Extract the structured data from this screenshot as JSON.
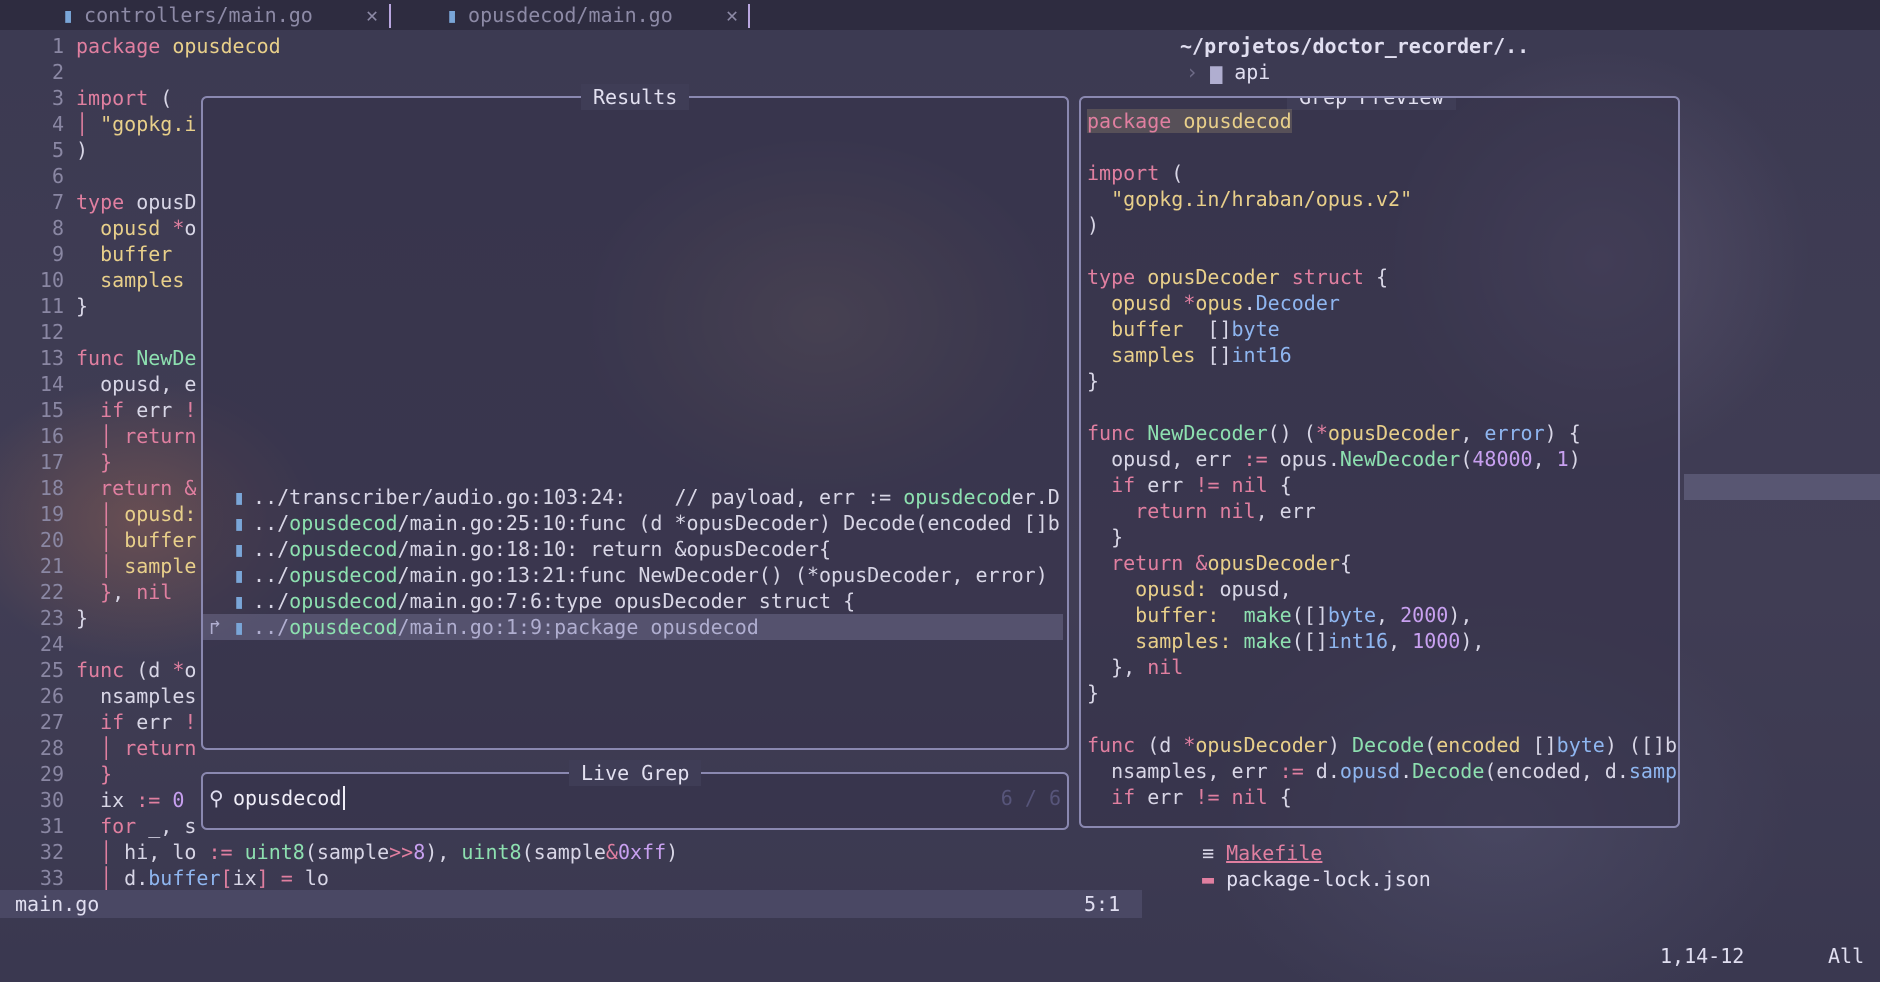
{
  "tabs": [
    {
      "label": "controllers/main.go",
      "close": "✕"
    },
    {
      "label": "opusdecod/main.go",
      "close": "✕"
    }
  ],
  "editor": {
    "lines": [
      {
        "n": "1",
        "html": "<span class='kw'>package</span> <span class='str'>opusdecod</span>"
      },
      {
        "n": "2",
        "html": ""
      },
      {
        "n": "3",
        "html": "<span class='kw'>import</span> ("
      },
      {
        "n": "4",
        "html": "<span class='guide'>│</span> <span class='str'>\"gopkg.i</span>"
      },
      {
        "n": "5",
        "html": ")"
      },
      {
        "n": "6",
        "html": ""
      },
      {
        "n": "7",
        "html": "<span class='kw'>type</span> opusD"
      },
      {
        "n": "8",
        "html": "  <span class='fld'>opusd</span> <span class='op'>*</span>o"
      },
      {
        "n": "9",
        "html": "  <span class='fld'>buffer</span>"
      },
      {
        "n": "10",
        "html": "  <span class='fld'>samples</span>"
      },
      {
        "n": "11",
        "html": "}"
      },
      {
        "n": "12",
        "html": ""
      },
      {
        "n": "13",
        "html": "<span class='kw'>func</span> <span class='fn'>NewDe</span>"
      },
      {
        "n": "14",
        "html": "  opusd, e"
      },
      {
        "n": "15",
        "html": "  <span class='kw'>if</span> err <span class='op'>!</span>"
      },
      {
        "n": "16",
        "html": "  <span class='guide'>│</span> <span class='kw'>return</span>"
      },
      {
        "n": "17",
        "html": "  <span class='guide'>}</span>"
      },
      {
        "n": "18",
        "html": "  <span class='kw'>return</span> <span class='op'>&amp;</span>"
      },
      {
        "n": "19",
        "html": "  <span class='guide'>│</span> <span class='fld'>opusd:</span>"
      },
      {
        "n": "20",
        "html": "  <span class='guide'>│</span> <span class='fld'>buffer</span>"
      },
      {
        "n": "21",
        "html": "  <span class='guide'>│</span> <span class='fld'>sample</span>"
      },
      {
        "n": "22",
        "html": "  <span class='guide'>}</span>, <span class='kw'>nil</span>"
      },
      {
        "n": "23",
        "html": "}"
      },
      {
        "n": "24",
        "html": ""
      },
      {
        "n": "25",
        "html": "<span class='kw'>func</span> (d <span class='op'>*</span>o"
      },
      {
        "n": "26",
        "html": "  nsamples"
      },
      {
        "n": "27",
        "html": "  <span class='kw'>if</span> err <span class='op'>!</span>"
      },
      {
        "n": "28",
        "html": "  <span class='guide'>│</span> <span class='kw'>return</span>"
      },
      {
        "n": "29",
        "html": "  <span class='guide'>}</span>"
      },
      {
        "n": "30",
        "html": "  ix <span class='op'>:=</span> <span class='num'>0</span>"
      },
      {
        "n": "31",
        "html": "  <span class='kw'>for</span> _, s"
      },
      {
        "n": "32",
        "html": "  <span class='guide'>│</span> hi, lo <span class='op'>:=</span> <span class='fn'>uint8</span>(sample<span class='op'>&gt;&gt;</span><span class='num'>8</span>), <span class='fn'>uint8</span>(sample<span class='op'>&amp;</span><span class='num'>0xff</span>)"
      },
      {
        "n": "33",
        "html": "  <span class='guide'>│</span> d.<span class='ty'>buffer</span><span class='op'>[</span>ix<span class='op'>]</span> <span class='op'>=</span> lo"
      }
    ]
  },
  "results": {
    "title": "Results",
    "rows": [
      {
        "path": "../transcriber/audio.go:103:24:    // payload, err := ",
        "match": "opusdecod",
        "rest": "er.D",
        "selected": false
      },
      {
        "path": "../",
        "match": "opusdecod",
        "rest": "/main.go:25:10:func (d *opusDecoder) Decode(encoded []b",
        "selected": false
      },
      {
        "path": "../",
        "match": "opusdecod",
        "rest": "/main.go:18:10: return &opusDecoder{",
        "selected": false
      },
      {
        "path": "../",
        "match": "opusdecod",
        "rest": "/main.go:13:21:func NewDecoder() (*opusDecoder, error)",
        "selected": false
      },
      {
        "path": "../",
        "match": "opusdecod",
        "rest": "/main.go:7:6:type opusDecoder struct {",
        "selected": false
      },
      {
        "path": "../",
        "match": "opusdecod",
        "rest": "/main.go:1:9:package opusdecod",
        "selected": true
      }
    ]
  },
  "live_grep": {
    "title": "Live Grep",
    "query": "opusdecod",
    "count": "6 / 6"
  },
  "preview": {
    "title": "Grep Preview",
    "lines": [
      "<span class='kw' style='background:rgba(232,207,138,.18)'>package</span><span style='background:rgba(232,207,138,.18)'> </span><span class='str' style='background:rgba(232,207,138,.18)'>opusdecod</span>",
      "",
      "<span class='kw'>import</span> (",
      "  <span class='str'>\"gopkg.in/hraban/opus.v2\"</span>",
      ")",
      "",
      "<span class='kw'>type</span> <span class='str'>opusDecoder</span> <span class='kw'>struct</span> {",
      "  <span class='fld'>opusd</span> <span class='op'>*</span><span class='str'>opus</span>.<span class='ty'>Decoder</span>",
      "  <span class='fld'>buffer</span>  []<span class='ty'>byte</span>",
      "  <span class='fld'>samples</span> []<span class='ty'>int16</span>",
      "}",
      "",
      "<span class='kw'>func</span> <span class='fn'>NewDecoder</span>() (<span class='op'>*</span><span class='str'>opusDecoder</span>, <span class='ty'>error</span>) {",
      "  opusd, err <span class='op'>:=</span> opus.<span class='fn'>NewDecoder</span>(<span class='num'>48000</span>, <span class='num'>1</span>)",
      "  <span class='kw'>if</span> err <span class='op'>!=</span> <span class='kw'>nil</span> {",
      "    <span class='kw'>return</span> <span class='kw'>nil</span>, err",
      "  }",
      "  <span class='kw'>return</span> <span class='op'>&amp;</span><span class='str'>opusDecoder</span>{",
      "    <span class='fld'>opusd:</span> opusd,",
      "    <span class='fld'>buffer:</span>  <span class='fn'>make</span>([]<span class='ty'>byte</span>, <span class='num'>2000</span>),",
      "    <span class='fld'>samples:</span> <span class='fn'>make</span>([]<span class='ty'>int16</span>, <span class='num'>1000</span>),",
      "  }, <span class='kw'>nil</span>",
      "}",
      "",
      "<span class='kw'>func</span> (d <span class='op'>*</span><span class='str'>opusDecoder</span>) <span class='fn'>Decode</span>(<span class='str'>encoded</span> []<span class='ty'>byte</span>) ([]b",
      "  nsamples, err <span class='op'>:=</span> d.<span class='ty'>opusd</span>.<span class='fn'>Decode</span>(encoded, d.<span class='ty'>samp</span>",
      "  <span class='kw'>if</span> err <span class='op'>!=</span> <span class='kw'>nil</span> {"
    ]
  },
  "tree": {
    "root": "~/projetos/doctor_recorder/..",
    "api": "api",
    "makefile": "Makefile",
    "pkglock": "package-lock.json"
  },
  "status": {
    "file": "main.go",
    "pos": "5:1"
  },
  "cmdline": {
    "pos": "1,14-12",
    "scroll": "All"
  },
  "colors": {
    "accent": "#e07fa0",
    "match": "#8de0b0",
    "border": "#8a88b0"
  }
}
